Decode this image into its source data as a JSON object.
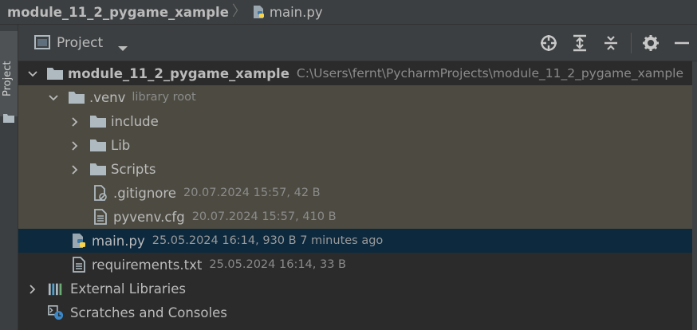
{
  "breadcrumb": {
    "project": "module_11_2_pygame_xample",
    "file": "main.py"
  },
  "strip": {
    "label": "Project"
  },
  "toolwindow": {
    "title": "Project",
    "toolbar": [
      "locate-icon",
      "expand-all-icon",
      "collapse-all-icon",
      "gear-icon",
      "minimize-icon"
    ]
  },
  "tree": {
    "root": {
      "name": "module_11_2_pygame_xample",
      "path": "C:\\Users\\fernt\\PycharmProjects\\module_11_2_pygame_xample"
    },
    "venv": {
      "name": ".venv",
      "hint": "library root"
    },
    "folders": [
      "include",
      "Lib",
      "Scripts"
    ],
    "gitignore": {
      "name": ".gitignore",
      "meta": "20.07.2024 15:57, 42 B"
    },
    "pyvenv": {
      "name": "pyvenv.cfg",
      "meta": "20.07.2024 15:57, 410 B"
    },
    "main": {
      "name": "main.py",
      "meta": "25.05.2024 16:14, 930 B 7 minutes ago"
    },
    "requirements": {
      "name": "requirements.txt",
      "meta": "25.05.2024 16:14, 33 B"
    },
    "external": "External Libraries",
    "scratches": "Scratches and Consoles"
  },
  "colors": {
    "background": "#2b2b2b",
    "panel": "#3c3f41",
    "venv_highlight": "#4d4b41",
    "selection": "#0d293e",
    "folder": "#aeb9c0",
    "python_blue": "#3c78aa",
    "python_yellow": "#f7d44a"
  }
}
